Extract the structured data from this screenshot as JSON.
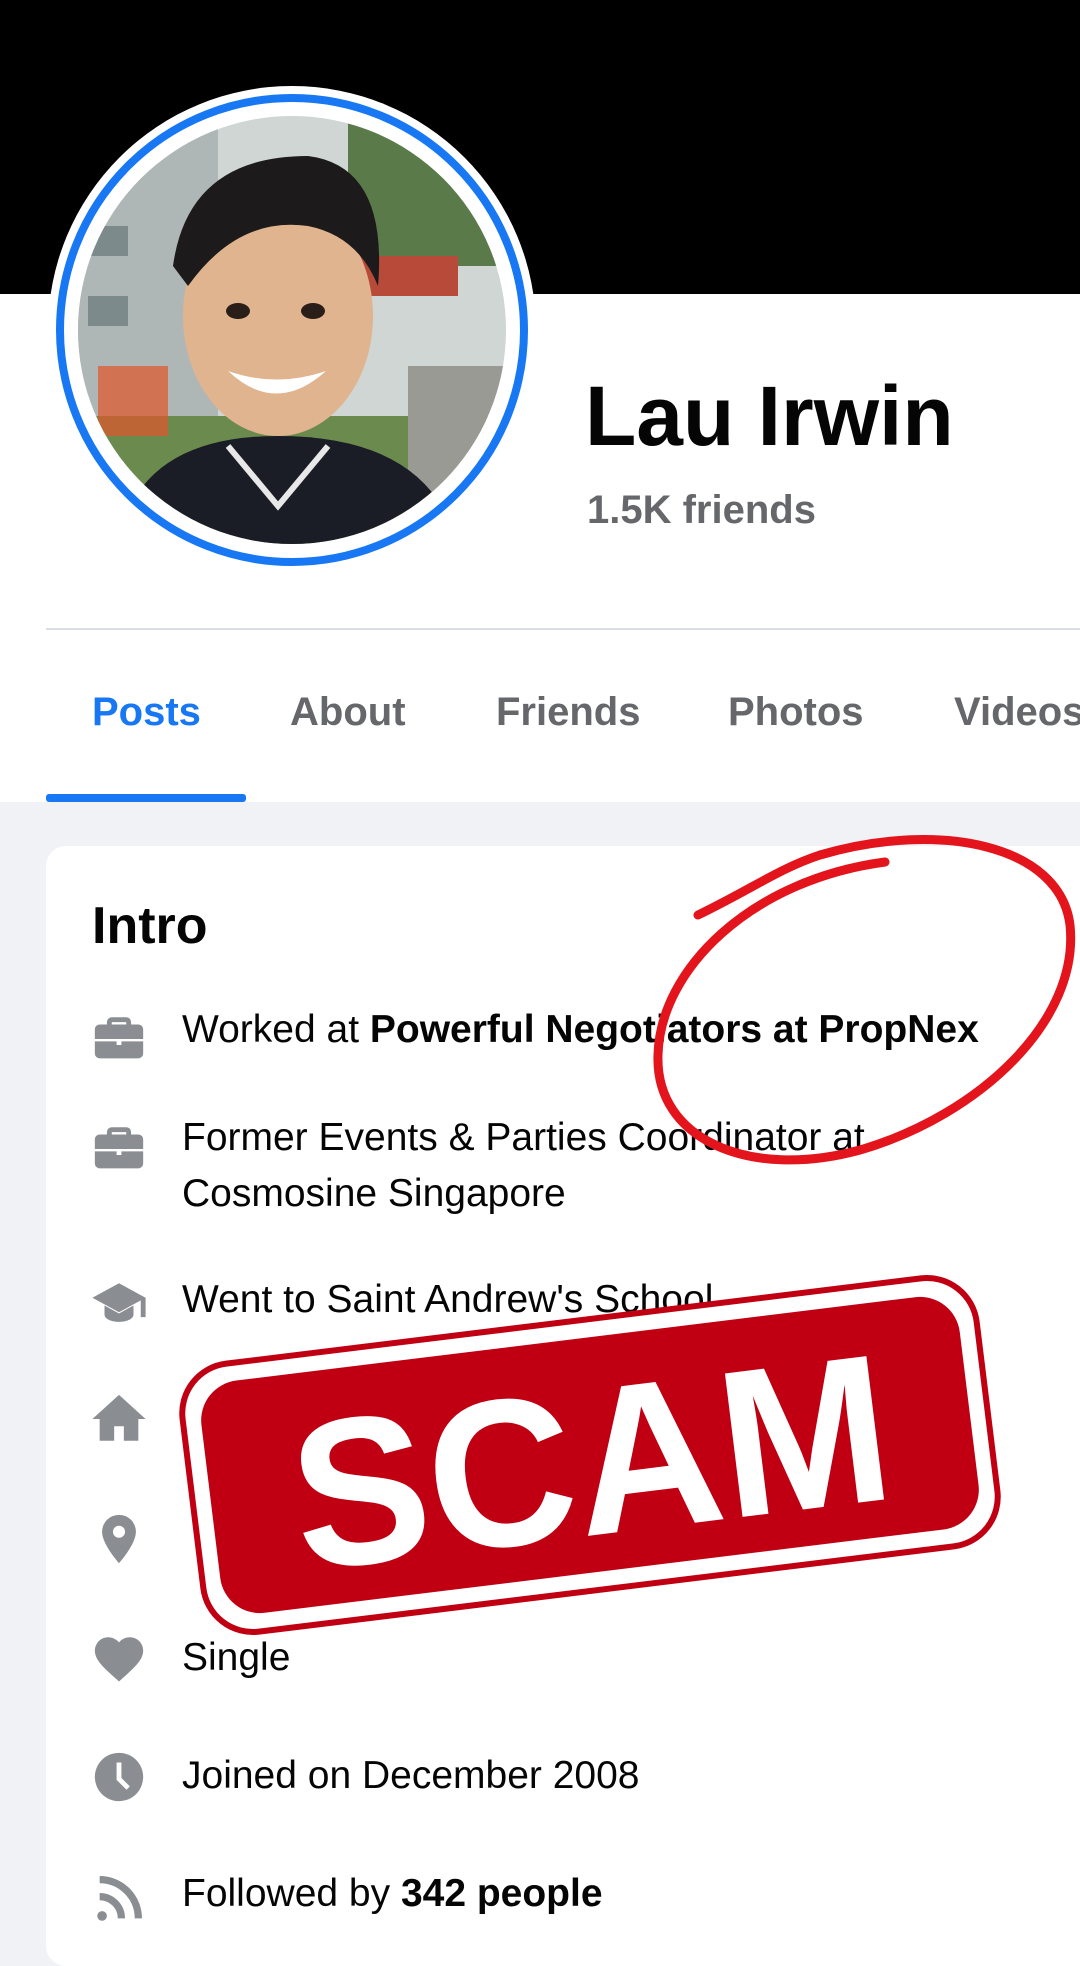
{
  "profile": {
    "name": "Lau Irwin",
    "friends": "1.5K friends"
  },
  "tabs": [
    {
      "label": "Posts",
      "active": true
    },
    {
      "label": "About",
      "active": false
    },
    {
      "label": "Friends",
      "active": false
    },
    {
      "label": "Photos",
      "active": false
    },
    {
      "label": "Videos",
      "active": false
    }
  ],
  "intro": {
    "title": "Intro",
    "items": [
      {
        "icon": "briefcase-icon",
        "prefix": "Worked at ",
        "bold": "Powerful Negotiators at PropNex",
        "suffix": ""
      },
      {
        "icon": "briefcase-icon",
        "prefix": "Former Events & Parties Coordinator at Cosmosine Singapore",
        "bold": "",
        "suffix": ""
      },
      {
        "icon": "graduation-cap-icon",
        "prefix": "Went to Saint Andrew's School",
        "bold": "",
        "suffix": ""
      },
      {
        "icon": "home-icon",
        "prefix": "",
        "bold": "",
        "suffix": ""
      },
      {
        "icon": "location-pin-icon",
        "prefix": "",
        "bold": "",
        "suffix": ""
      },
      {
        "icon": "heart-icon",
        "prefix": "Single",
        "bold": "",
        "suffix": ""
      },
      {
        "icon": "clock-icon",
        "prefix": "Joined on December 2008",
        "bold": "",
        "suffix": ""
      },
      {
        "icon": "rss-icon",
        "prefix": "Followed by ",
        "bold": "342 people",
        "suffix": ""
      }
    ]
  },
  "overlay": {
    "stamp_text": "SCAM",
    "stamp_color": "#c00012",
    "annotation_color": "#e3141c"
  },
  "colors": {
    "accent": "#1877f2",
    "secondary_text": "#65676b",
    "icon_gray": "#8a8d91"
  }
}
